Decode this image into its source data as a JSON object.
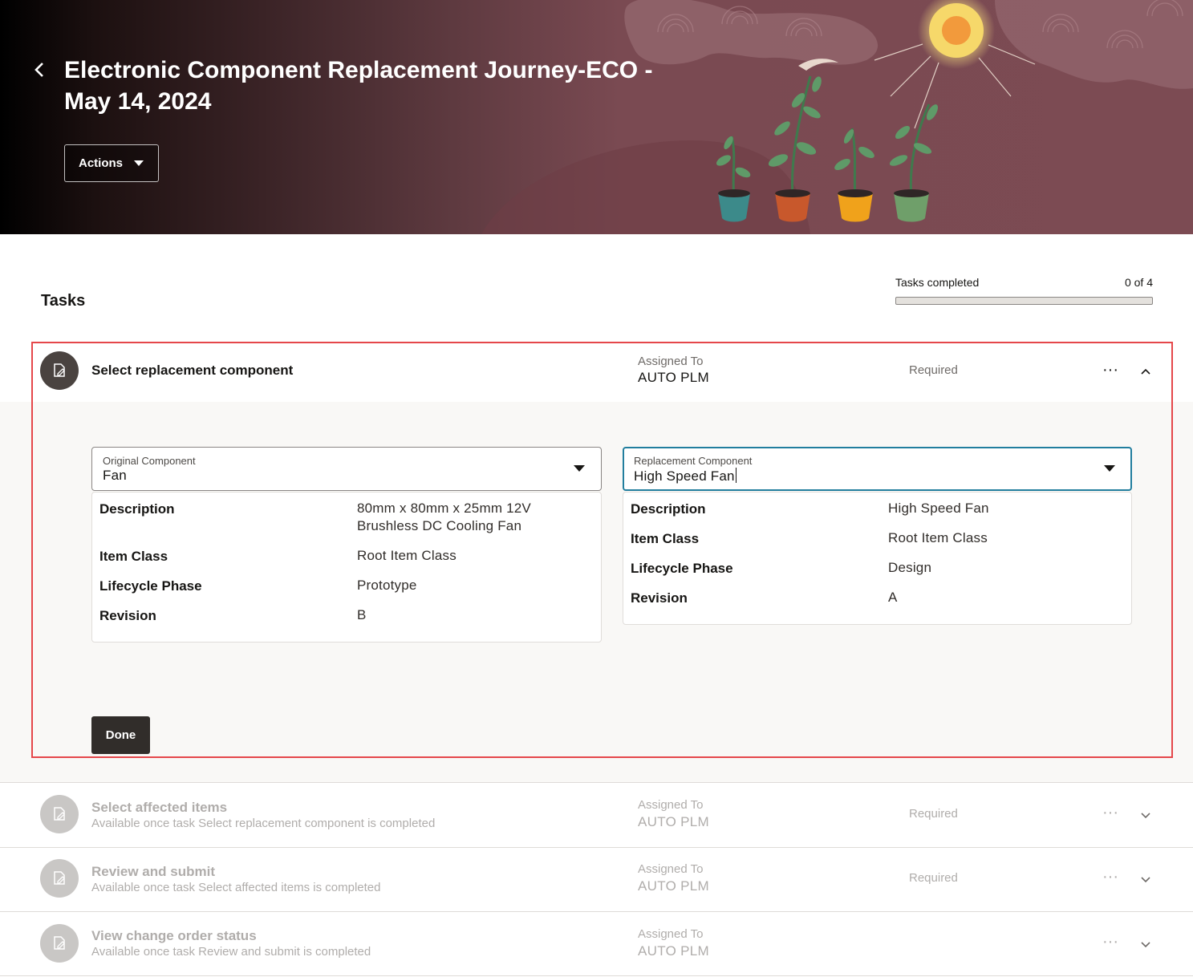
{
  "header": {
    "title": "Electronic Component Replacement Journey-ECO - May 14, 2024",
    "actions_label": "Actions"
  },
  "tasks_section": {
    "title": "Tasks",
    "progress_label": "Tasks completed",
    "progress_count": "0 of 4",
    "progress_fraction": 0
  },
  "tasks": [
    {
      "name": "Select replacement component",
      "subtitle": "",
      "assigned_label": "Assigned To",
      "assigned_value": "AUTO PLM",
      "required": "Required",
      "more": "···"
    },
    {
      "name": "Select affected items",
      "subtitle": "Available once task Select replacement component is completed",
      "assigned_label": "Assigned To",
      "assigned_value": "AUTO PLM",
      "required": "Required",
      "more": "···"
    },
    {
      "name": "Review and submit",
      "subtitle": "Available once task Select affected items is completed",
      "assigned_label": "Assigned To",
      "assigned_value": "AUTO PLM",
      "required": "Required",
      "more": "···"
    },
    {
      "name": "View change order status",
      "subtitle": "Available once task Review and submit is completed",
      "assigned_label": "Assigned To",
      "assigned_value": "AUTO PLM",
      "required": "",
      "more": "···"
    }
  ],
  "original": {
    "label": "Original Component",
    "value": "Fan",
    "details": [
      {
        "key": "Description",
        "value": "80mm x 80mm x 25mm 12V Brushless DC Cooling Fan"
      },
      {
        "key": "Item Class",
        "value": "Root Item Class"
      },
      {
        "key": "Lifecycle Phase",
        "value": "Prototype"
      },
      {
        "key": "Revision",
        "value": "B"
      }
    ]
  },
  "replacement": {
    "label": "Replacement Component",
    "value": "High Speed Fan",
    "details": [
      {
        "key": "Description",
        "value": "High Speed Fan"
      },
      {
        "key": "Item Class",
        "value": "Root Item Class"
      },
      {
        "key": "Lifecycle Phase",
        "value": "Design"
      },
      {
        "key": "Revision",
        "value": "A"
      }
    ]
  },
  "done_label": "Done",
  "colors": {
    "accent": "#227e9e",
    "highlight": "#e5474a",
    "banner": "#7c4b53",
    "dark_button": "#312d2a"
  }
}
